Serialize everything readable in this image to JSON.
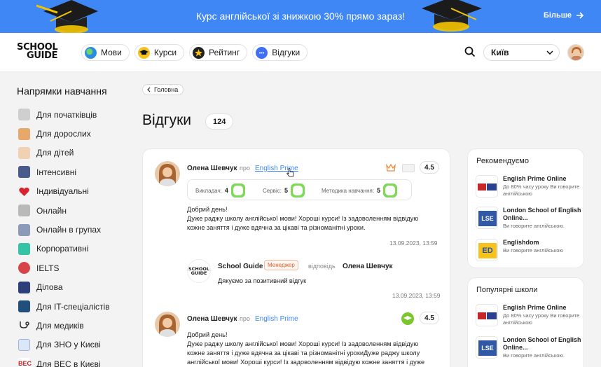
{
  "promo": {
    "text": "Курс англійської зі знижкою 30% прямо зараз!",
    "more": "Більше",
    "color": "#3f87f5"
  },
  "logo": {
    "line1": "SCHOOL",
    "line2": "GUIDE"
  },
  "nav": [
    {
      "label": "Мови",
      "icon": "globe-icon"
    },
    {
      "label": "Курси",
      "icon": "graduation-cap-icon"
    },
    {
      "label": "Рейтинг",
      "icon": "star-icon"
    },
    {
      "label": "Відгуки",
      "icon": "chat-bubble-icon"
    }
  ],
  "city": {
    "value": "Київ"
  },
  "sidebar": {
    "title": "Напрямки навчання",
    "items": [
      {
        "label": "Для початківців",
        "icon": "beginner-icon"
      },
      {
        "label": "Для дорослих",
        "icon": "adult-icon"
      },
      {
        "label": "Для дітей",
        "icon": "kids-icon"
      },
      {
        "label": "Інтенсивні",
        "icon": "rocket-icon"
      },
      {
        "label": "Індивідуальні",
        "icon": "heart-icon"
      },
      {
        "label": "Онлайн",
        "icon": "laptop-icon"
      },
      {
        "label": "Онлайн в групах",
        "icon": "group-screen-icon"
      },
      {
        "label": "Корпоративні",
        "icon": "puzzle-icon"
      },
      {
        "label": "IELTS",
        "icon": "ielts-icon"
      },
      {
        "label": "Ділова",
        "icon": "tie-icon"
      },
      {
        "label": "Для IT-спеціалістів",
        "icon": "it-icon"
      },
      {
        "label": "Для медиків",
        "icon": "stethoscope-icon"
      },
      {
        "label": "Для ЗНО у Києві",
        "icon": "test-sheet-icon"
      },
      {
        "label": "Для ВЕС в Києві",
        "icon": "bec-icon"
      }
    ]
  },
  "breadcrumb": {
    "label": "Головна"
  },
  "page": {
    "title": "Відгуки",
    "count": "124"
  },
  "reviews": [
    {
      "author": "Олена Шевчук",
      "about": "про",
      "school": "English Prime",
      "rating": "4.5",
      "scores": [
        {
          "label": "Викладач:",
          "value": "4"
        },
        {
          "label": "Сервіс:",
          "value": "5"
        },
        {
          "label": "Методика навчання:",
          "value": "5"
        }
      ],
      "text_lines": [
        "Добрий день!",
        "Дуже раджу школу англійської мови! Хороші курси! Із задоволенням відвідую",
        "кожне заняття і дуже вдячна за цікаві та різноманітні уроки."
      ],
      "date": "13.09.2023, 13:59",
      "reply": {
        "logo_line1": "SCHOOL",
        "logo_line2": "GUIDE",
        "author": "School Guide",
        "role": "Менеджер",
        "verb": "відповідь",
        "to": "Олена Шевчук",
        "text": "Дякуємо за позитивний відгук",
        "date": "13.09.2023, 13:59"
      }
    },
    {
      "author": "Олена Шевчук",
      "about": "про",
      "school": "English Prime",
      "rating": "4.5",
      "text_lines": [
        "Добрий день!",
        "Дуже раджу школу англійської мови! Хороші курси! Із задоволенням відвідую",
        "кожне заняття і дуже вдячна за цікаві та різноманітні урокиДуже раджу школу",
        "англійської мови! Хороші курси! Із задоволенням відвідую кожне заняття і дуже"
      ]
    }
  ],
  "recommended": {
    "title": "Рекомендуємо",
    "items": [
      {
        "name": "English Prime Online",
        "desc": "До 80% часу уроку Ви говорите англійською"
      },
      {
        "name": "London School of English Online...",
        "desc": "Ви говорите англійською."
      },
      {
        "name": "Englishdom",
        "desc": "Ви говорите англійською"
      }
    ]
  },
  "popular": {
    "title": "Популярні школи",
    "items": [
      {
        "name": "English Prime Online",
        "desc": "До 80% часу уроку Ви говорите англійською"
      },
      {
        "name": "London School of English Online...",
        "desc": "Ви говорите англійською."
      }
    ]
  },
  "colors": {
    "accent": "#3f87f5",
    "score_green": "#7ed957",
    "manager_orange": "#e5602d"
  }
}
